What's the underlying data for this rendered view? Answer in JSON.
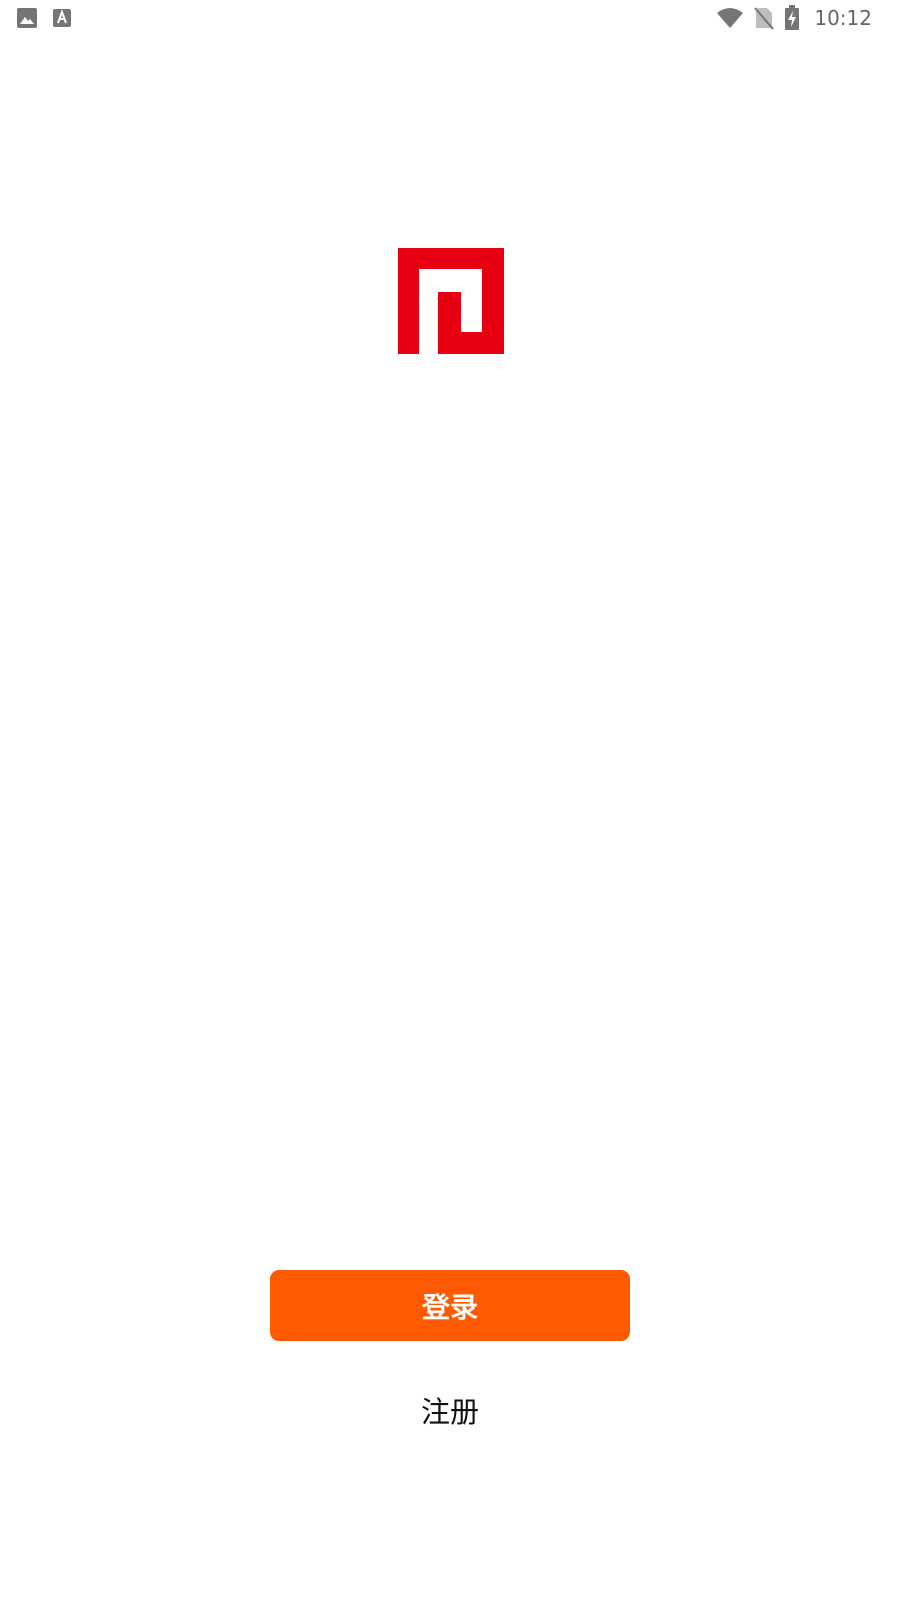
{
  "status_bar": {
    "time": "10:12",
    "icons": [
      "gallery-notification-icon",
      "font-notification-icon",
      "wifi-icon",
      "no-sim-icon",
      "battery-charging-icon"
    ],
    "icon_color": "#757575"
  },
  "logo": {
    "name": "red-square-logo",
    "color": "#e60012"
  },
  "actions": {
    "login_label": "登录",
    "register_label": "注册"
  },
  "colors": {
    "accent": "#ff5a00",
    "background": "#ffffff"
  }
}
